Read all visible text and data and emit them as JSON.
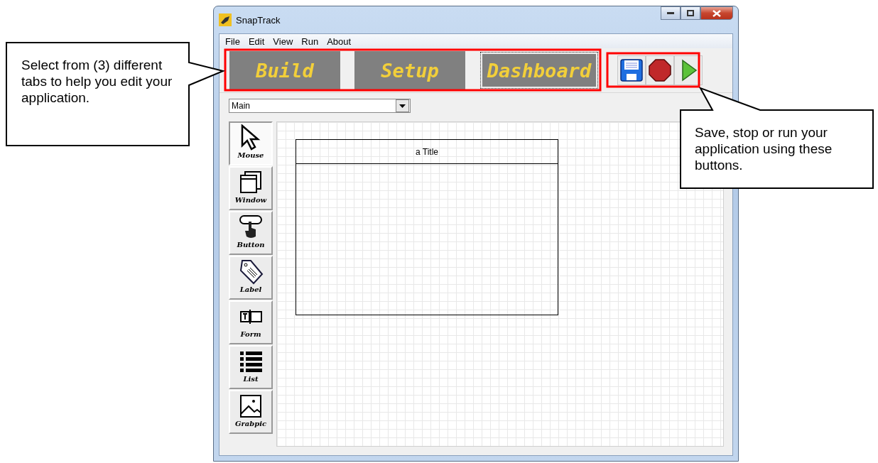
{
  "window": {
    "title": "SnapTrack"
  },
  "menu": [
    "File",
    "Edit",
    "View",
    "Run",
    "About"
  ],
  "tabs": [
    {
      "label": "Build",
      "focused": false
    },
    {
      "label": "Setup",
      "focused": false
    },
    {
      "label": "Dashboard",
      "focused": true
    }
  ],
  "toolbar": [
    {
      "kind": "save"
    },
    {
      "kind": "stop"
    },
    {
      "kind": "run"
    }
  ],
  "screen_select": {
    "value": "Main"
  },
  "tools": [
    {
      "label": "Mouse",
      "kind": "pointer",
      "selected": true
    },
    {
      "label": "Window",
      "kind": "window",
      "selected": false
    },
    {
      "label": "Button",
      "kind": "button",
      "selected": false
    },
    {
      "label": "Label",
      "kind": "tag",
      "selected": false
    },
    {
      "label": "Form",
      "kind": "form",
      "selected": false
    },
    {
      "label": "List",
      "kind": "list",
      "selected": false
    },
    {
      "label": "Grabpic",
      "kind": "image",
      "selected": false
    }
  ],
  "canvas": {
    "widgets": [
      {
        "kind": "window",
        "title": "a Title"
      }
    ]
  },
  "callouts": [
    {
      "text": "Select from (3) different tabs to help you edit your application."
    },
    {
      "text": "Save, stop or run your application using these buttons."
    }
  ]
}
